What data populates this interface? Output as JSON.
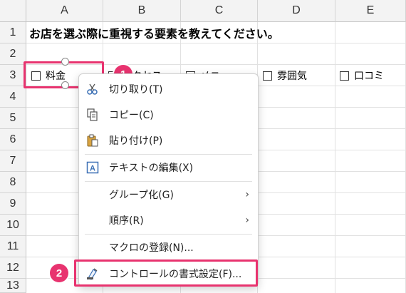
{
  "columns": [
    "A",
    "B",
    "C",
    "D",
    "E"
  ],
  "rows": [
    "1",
    "2",
    "3",
    "4",
    "5",
    "6",
    "7",
    "8",
    "9",
    "10",
    "11",
    "12",
    "13"
  ],
  "sheet": {
    "title": "お店を選ぶ際に重視する要素を教えてください。",
    "checkboxes": [
      "料金",
      "アクセス",
      "メニュー",
      "雰囲気",
      "口コミ"
    ]
  },
  "callouts": {
    "first": "1",
    "second": "2"
  },
  "context_menu": {
    "items": [
      {
        "label": "切り取り(T)",
        "icon": "scissors-icon"
      },
      {
        "label": "コピー(C)",
        "icon": "copy-icon"
      },
      {
        "label": "貼り付け(P)",
        "icon": "paste-icon"
      },
      {
        "label": "テキストの編集(X)",
        "icon": "edit-text-icon"
      },
      {
        "label": "グループ化(G)",
        "submenu": true
      },
      {
        "label": "順序(R)",
        "submenu": true
      },
      {
        "label": "マクロの登録(N)..."
      },
      {
        "label": "コントロールの書式設定(F)...",
        "icon": "format-control-icon"
      }
    ],
    "submenu_arrow": "›"
  },
  "colors": {
    "accent": "#e8336f"
  }
}
